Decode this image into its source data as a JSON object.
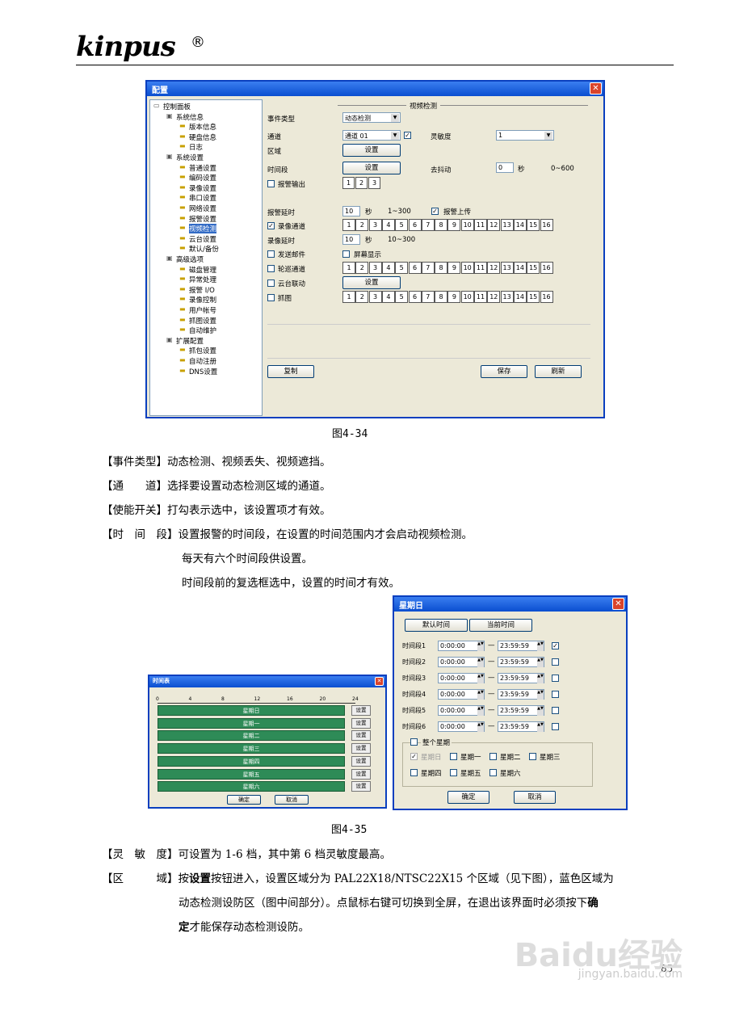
{
  "header": {
    "logo": "kinpus",
    "reg": "®"
  },
  "config_window": {
    "title": "配置",
    "tree": [
      "控制面板",
      "系统信息",
      "版本信息",
      "硬盘信息",
      "日志",
      "系统设置",
      "普通设置",
      "编码设置",
      "录像设置",
      "串口设置",
      "网络设置",
      "报警设置",
      "视频检测",
      "云台设置",
      "默认/备份",
      "高级选项",
      "磁盘管理",
      "异常处理",
      "报警 I/O",
      "录像控制",
      "用户帐号",
      "抓图设置",
      "自动维护",
      "扩展配置",
      "抓包设置",
      "自动注册",
      "DNS设置"
    ],
    "section": "视频检测",
    "labels": {
      "event_type": "事件类型",
      "channel": "通道",
      "sensitivity": "灵敏度",
      "region": "区域",
      "period": "时间段",
      "debounce": "去抖动",
      "alarm_out": "报警输出",
      "alarm_delay": "报警延时",
      "alarm_upload": "报警上传",
      "record_channel": "录像通道",
      "record_delay": "录像延时",
      "send_mail": "发送邮件",
      "screen_show": "屏幕显示",
      "tour_channel": "轮巡通道",
      "ptz_link": "云台联动",
      "snapshot": "抓图"
    },
    "values": {
      "event_type": "动态检测",
      "channel": "通道 01",
      "sensitivity": "1",
      "debounce": "0",
      "debounce_unit": "秒",
      "debounce_range": "0~600",
      "alarm_delay": "10",
      "alarm_delay_unit": "秒",
      "alarm_delay_range": "1~300",
      "record_delay": "10",
      "record_delay_unit": "秒",
      "record_delay_range": "10~300"
    },
    "buttons": {
      "setup": "设置",
      "copy": "复制",
      "save": "保存",
      "refresh": "刷新"
    },
    "alarm_nums": [
      "1",
      "2",
      "3"
    ],
    "channel_nums": [
      "1",
      "2",
      "3",
      "4",
      "5",
      "6",
      "7",
      "8",
      "9",
      "10",
      "11",
      "12",
      "13",
      "14",
      "15",
      "16"
    ]
  },
  "fig1": "图4-34",
  "paragraphs": [
    {
      "k": "【事件类型】",
      "t": "动态检测、视频丢失、视频遮挡。"
    },
    {
      "k": "【通　　道】",
      "t": "选择要设置动态检测区域的通道。"
    },
    {
      "k": "【使能开关】",
      "t": "打勾表示选中，该设置项才有效。"
    },
    {
      "k": "【时　间　段】",
      "t": "设置报警的时间段，在设置的时间范围内才会启动视频检测。"
    }
  ],
  "indent1": "每天有六个时间段供设置。",
  "indent2": "时间段前的复选框选中，设置的时间才有效。",
  "schedule_window": {
    "title": "时间表",
    "ticks": [
      "0",
      "4",
      "8",
      "12",
      "16",
      "20",
      "24"
    ],
    "days": [
      "星期日",
      "星期一",
      "星期二",
      "星期三",
      "星期四",
      "星期五",
      "星期六"
    ],
    "set": "设置",
    "ok": "确定",
    "cancel": "取消"
  },
  "day_window": {
    "title": "星期日",
    "default_time": "默认时间",
    "current_time": "当前时间",
    "periods": [
      {
        "l": "时间段1",
        "s": "0:00:00",
        "e": "23:59:59"
      },
      {
        "l": "时间段2",
        "s": "0:00:00",
        "e": "23:59:59"
      },
      {
        "l": "时间段3",
        "s": "0:00:00",
        "e": "23:59:59"
      },
      {
        "l": "时间段4",
        "s": "0:00:00",
        "e": "23:59:59"
      },
      {
        "l": "时间段5",
        "s": "0:00:00",
        "e": "23:59:59"
      },
      {
        "l": "时间段6",
        "s": "0:00:00",
        "e": "23:59:59"
      }
    ],
    "whole_week": "整个星期",
    "week": [
      "星期日",
      "星期一",
      "星期二",
      "星期三",
      "星期四",
      "星期五",
      "星期六"
    ],
    "ok": "确定",
    "cancel": "取消"
  },
  "fig2": "图4-35",
  "para_sens": {
    "k": "【灵　敏　度】",
    "t": "可设置为 1-6 档，其中第 6 档灵敏度最高。"
  },
  "para_region": {
    "k": "【区　　　域】",
    "t1": "按",
    "b1": "设置",
    "t2": "按钮进入，设置区域分为 PAL22X18/NTSC22X15 个区域（见下图），蓝色区域为",
    "t3": "动态检测设防区（图中间部分）。点鼠标右键可切换到全屏，在退出该界面时必须按下",
    "b2": "确",
    "b3": "定",
    "t4": "才能保存动态检测设防。"
  },
  "page_number": "85",
  "watermark": {
    "brand": "Baidu经验",
    "url": "jingyan.baidu.com"
  }
}
